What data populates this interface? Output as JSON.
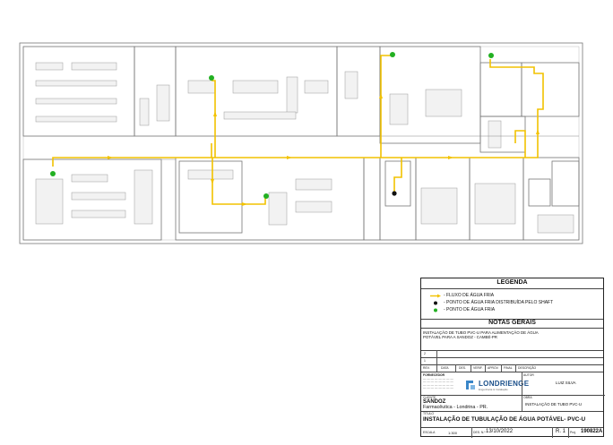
{
  "legend": {
    "title": "LEGENDA",
    "items": [
      {
        "symbol": "arrow-line",
        "color": "#f2c200",
        "label": "- FLUXO DE ÁGUA FRIA"
      },
      {
        "symbol": "dot",
        "color": "#111111",
        "label": "- PONTO DE ÁGUA FRIA DISTRIBUÍDA PELO SHAFT"
      },
      {
        "symbol": "dot",
        "color": "#22b022",
        "label": "- PONTO DE ÁGUA FRIA"
      }
    ]
  },
  "notes": {
    "title": "NOTAS GERAIS",
    "text": "INSTALAÇÃO DE TUBO PVC-U PARA ALIMENTAÇÃO DE ÁGUA POTÁVEL PARA A SANDOZ - CAMBÉ-PR"
  },
  "revisions": {
    "rows": [
      "2",
      "1"
    ],
    "headers": [
      "REV.",
      "DATA",
      "DES.",
      "VERIF.",
      "APROV.",
      "FINAL",
      "DESCRIÇÃO"
    ]
  },
  "company": {
    "label": "FORNECEDOR",
    "logo_text": "LONDRIENGE",
    "logo_sub": "Engenharia & Instalação",
    "author_label": "AUTOR",
    "author": "LUIZ SILVA",
    "obra_label": "OBRA",
    "obra": "INSTALAÇÃO DE TUBO PVC-U"
  },
  "client": {
    "label": "CLIENTE",
    "name": "SANDOZ",
    "location": "Farmacêutica - Londrina - PR."
  },
  "title_block": {
    "label": "TÍTULO",
    "title": "INSTALAÇÃO DE TUBULAÇÃO DE ÁGUA POTÁVEL- PVC-U",
    "escala_label": "ESCALA",
    "escala": "1:300",
    "data_label": "DES. N.º",
    "data": "13/10/2022",
    "rev_label": "R. 1",
    "proj_label": "Proj.",
    "proj": "190822A"
  },
  "colors": {
    "pipe": "#f2c200",
    "green_point": "#22b022",
    "shaft_point": "#111111",
    "walls": "#555555"
  }
}
